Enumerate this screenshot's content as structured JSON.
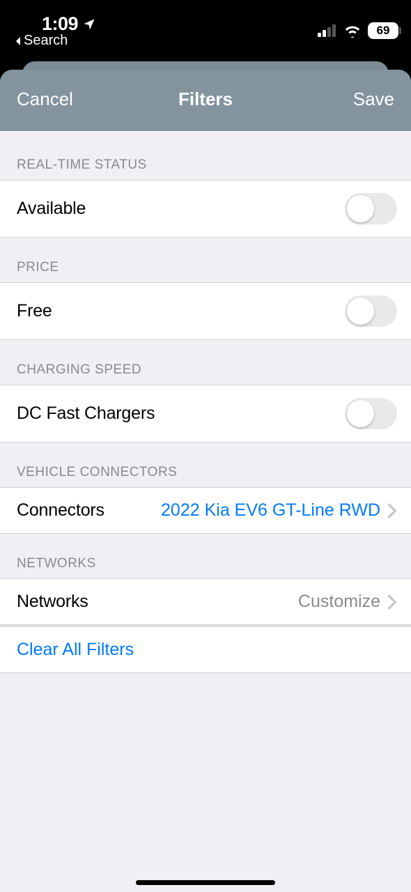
{
  "status": {
    "time": "1:09",
    "back_label": "Search",
    "battery": "69"
  },
  "nav": {
    "cancel": "Cancel",
    "title": "Filters",
    "save": "Save"
  },
  "sections": {
    "realtime": {
      "header": "REAL-TIME STATUS",
      "available_label": "Available"
    },
    "price": {
      "header": "PRICE",
      "free_label": "Free"
    },
    "speed": {
      "header": "CHARGING SPEED",
      "dc_fast_label": "DC Fast Chargers"
    },
    "connectors": {
      "header": "VEHICLE CONNECTORS",
      "label": "Connectors",
      "value": "2022 Kia EV6 GT-Line RWD"
    },
    "networks": {
      "header": "NETWORKS",
      "label": "Networks",
      "value": "Customize"
    }
  },
  "clear_all": "Clear All Filters"
}
